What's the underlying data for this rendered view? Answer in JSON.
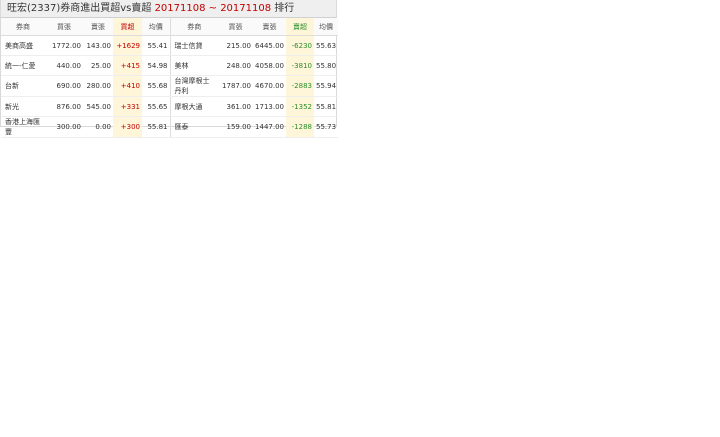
{
  "title": {
    "prefix": "旺宏(2337)券商進出買超vs賣超 ",
    "date_range": "20171108 ~ 20171108",
    "suffix": " 排行"
  },
  "headers": {
    "broker": "券商",
    "buy": "買張",
    "sell": "賣張",
    "net_buy": "買超",
    "net_sell": "賣超",
    "avg": "均價"
  },
  "buy_rows": [
    {
      "broker": "美商高盛",
      "buy": "1772.00",
      "sell": "143.00",
      "net": "+1629",
      "avg": "55.41"
    },
    {
      "broker": "統一-仁愛",
      "buy": "440.00",
      "sell": "25.00",
      "net": "+415",
      "avg": "54.98"
    },
    {
      "broker": "台新",
      "buy": "690.00",
      "sell": "280.00",
      "net": "+410",
      "avg": "55.68"
    },
    {
      "broker": "新光",
      "buy": "876.00",
      "sell": "545.00",
      "net": "+331",
      "avg": "55.65"
    },
    {
      "broker": "香港上海匯豐",
      "buy": "300.00",
      "sell": "0.00",
      "net": "+300",
      "avg": "55.81"
    }
  ],
  "sell_rows": [
    {
      "broker": "瑞士信貸",
      "buy": "215.00",
      "sell": "6445.00",
      "net": "-6230",
      "avg": "55.63"
    },
    {
      "broker": "美林",
      "buy": "248.00",
      "sell": "4058.00",
      "net": "-3810",
      "avg": "55.80"
    },
    {
      "broker": "台灣摩根士丹利",
      "buy": "1787.00",
      "sell": "4670.00",
      "net": "-2883",
      "avg": "55.94"
    },
    {
      "broker": "摩根大通",
      "buy": "361.00",
      "sell": "1713.00",
      "net": "-1352",
      "avg": "55.81"
    },
    {
      "broker": "匯泰",
      "buy": "159.00",
      "sell": "1447.00",
      "net": "-1288",
      "avg": "55.73"
    }
  ]
}
